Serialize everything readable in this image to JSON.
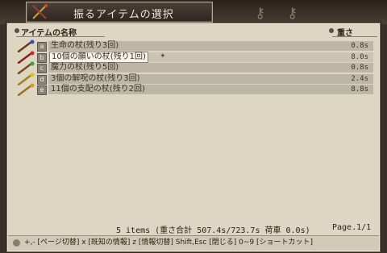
{
  "title": "振るアイテムの選択",
  "header": {
    "name_col": "アイテムの名称",
    "weight_col": "重さ"
  },
  "items": [
    {
      "key": "a",
      "name": "生命の杖(残り3回)",
      "weight": "0.8s",
      "staff_color": "#6a3a1a",
      "gem_color": "#3050c0"
    },
    {
      "key": "b",
      "name": "10個の願いの杖(残り1回)",
      "weight": "8.0s",
      "staff_color": "#8a2018",
      "gem_color": "#c03020"
    },
    {
      "key": "c",
      "name": "魔力の杖(残り5回)",
      "weight": "0.8s",
      "staff_color": "#7a4a1a",
      "gem_color": "#40a040"
    },
    {
      "key": "d",
      "name": "3個の解呪の杖(残り3回)",
      "weight": "2.4s",
      "staff_color": "#a08020",
      "gem_color": "#e0c020"
    },
    {
      "key": "e",
      "name": "11個の支配の杖(残り2回)",
      "weight": "8.8s",
      "staff_color": "#a07020",
      "gem_color": "#d0a020"
    }
  ],
  "selected_index": 1,
  "footer": {
    "summary": "5 items  (重さ合計 507.4s/723.7s  荷車 0.0s)",
    "page": "Page.1/1"
  },
  "help": "+,- [ページ切替]  x [既知の情報]  z [情報切替]  Shift,Esc [閉じる]  0~9 [ショートカット]",
  "colors": {
    "panel": "#ddd6c2",
    "row": "#bcb6a6",
    "accent": "#3a3428"
  }
}
